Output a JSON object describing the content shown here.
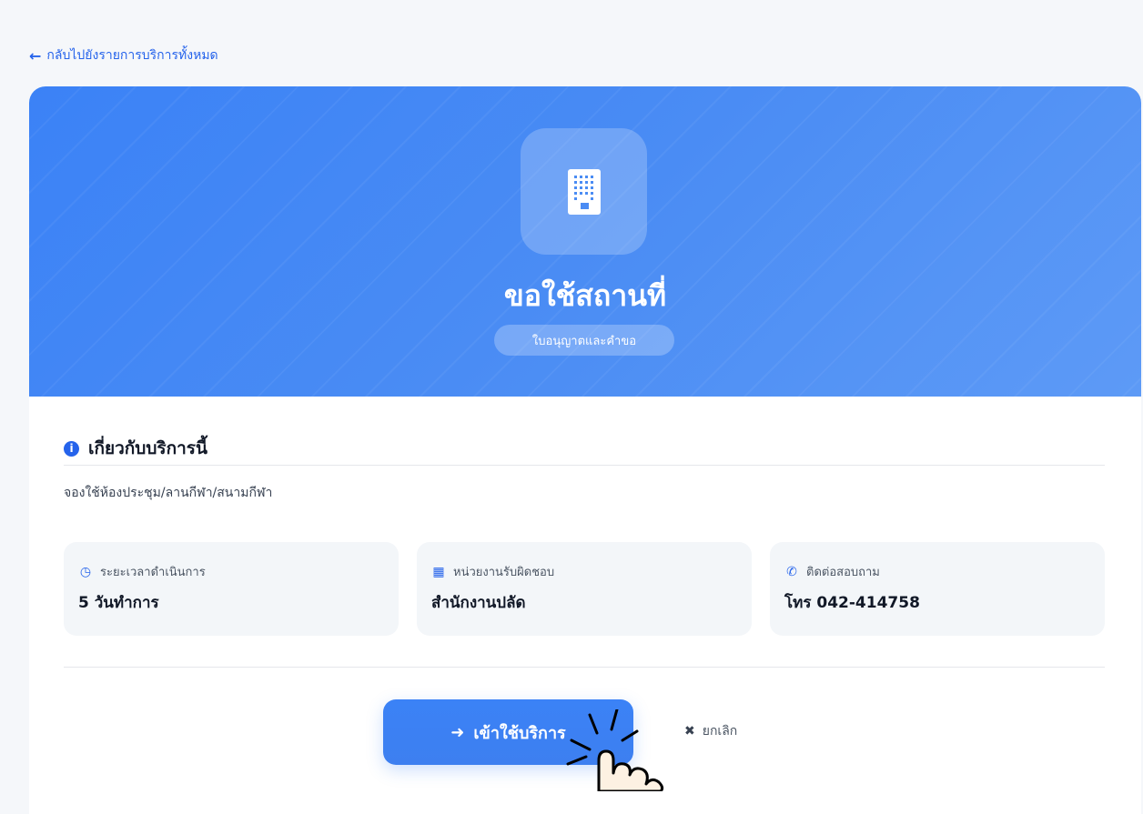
{
  "nav": {
    "back_label": "กลับไปยังรายการบริการทั้งหมด",
    "back_icon": "arrow-left-icon"
  },
  "hero": {
    "icon": "building-icon",
    "title": "ขอใช้สถานที่",
    "category_badge": "ใบอนุญาตและคำขอ",
    "color_start": "#3b82f6",
    "color_end": "#5d9af6"
  },
  "about": {
    "heading": "เกี่ยวกับบริการนี้",
    "icon": "info-icon",
    "description": "จองใช้ห้องประชุม/ลานกีฬา/สนามกีฬา"
  },
  "info_cards": [
    {
      "icon": "clock-icon",
      "label": "ระยะเวลาดำเนินการ",
      "value": "5 วันทำการ"
    },
    {
      "icon": "building-icon",
      "label": "หน่วยงานรับผิดชอบ",
      "value": "สำนักงานปลัด"
    },
    {
      "icon": "phone-icon",
      "label": "ติดต่อสอบถาม",
      "value": "โทร 042-414758"
    }
  ],
  "actions": {
    "primary_label": "เข้าใช้บริการ",
    "primary_icon": "arrow-right-icon",
    "cancel_label": "ยกเลิก",
    "cancel_icon": "close-icon"
  },
  "colors": {
    "accent": "#2563eb",
    "primary_button": "#3b82f6",
    "card_bg": "#f3f6f9"
  }
}
